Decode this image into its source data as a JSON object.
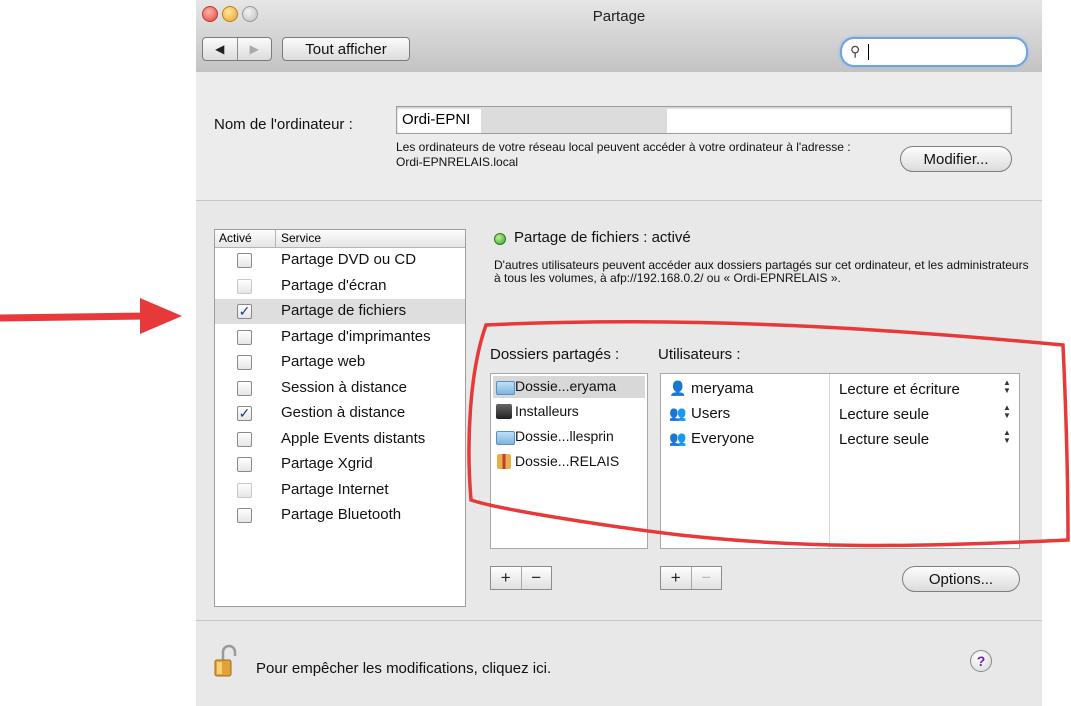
{
  "window": {
    "title": "Partage",
    "show_all": "Tout afficher",
    "nav_back": "◀",
    "nav_forward": "▶"
  },
  "search": {
    "placeholder": ""
  },
  "computer_name": {
    "label": "Nom de l'ordinateur :",
    "value": "Ordi-EPNI",
    "address_text": "Les ordinateurs de votre réseau local peuvent accéder à votre ordinateur à l'adresse : Ordi-EPNRELAIS.local",
    "modify_button": "Modifier..."
  },
  "services": {
    "header_enabled": "Activé",
    "header_service": "Service",
    "items": [
      {
        "label": "Partage DVD ou CD",
        "checked": false,
        "enabled": true
      },
      {
        "label": "Partage d'écran",
        "checked": false,
        "enabled": false
      },
      {
        "label": "Partage de fichiers",
        "checked": true,
        "enabled": true,
        "selected": true
      },
      {
        "label": "Partage d'imprimantes",
        "checked": false,
        "enabled": true
      },
      {
        "label": "Partage web",
        "checked": false,
        "enabled": true
      },
      {
        "label": "Session à distance",
        "checked": false,
        "enabled": true
      },
      {
        "label": "Gestion à distance",
        "checked": true,
        "enabled": true
      },
      {
        "label": "Apple Events distants",
        "checked": false,
        "enabled": true
      },
      {
        "label": "Partage Xgrid",
        "checked": false,
        "enabled": true
      },
      {
        "label": "Partage Internet",
        "checked": false,
        "enabled": false
      },
      {
        "label": "Partage Bluetooth",
        "checked": false,
        "enabled": true
      }
    ]
  },
  "status": {
    "text": "Partage de fichiers : activé",
    "description": "D'autres utilisateurs peuvent accéder aux dossiers partagés sur cet ordinateur, et les administrateurs à tous les volumes, à afp://192.168.0.2/ ou « Ordi-EPNRELAIS ».",
    "color": "#3aa522"
  },
  "shared_folders": {
    "label": "Dossiers partagés :",
    "items": [
      {
        "label": "Dossie...eryama",
        "icon": "folder-icon",
        "selected": true
      },
      {
        "label": "Installeurs",
        "icon": "box-icon"
      },
      {
        "label": "Dossie...llesprin",
        "icon": "folder-icon"
      },
      {
        "label": "Dossie...RELAIS",
        "icon": "gift-icon"
      }
    ]
  },
  "users": {
    "label": "Utilisateurs :",
    "items": [
      {
        "name": "meryama",
        "icon": "user-icon",
        "permission": "Lecture et écriture"
      },
      {
        "name": "Users",
        "icon": "group-icon",
        "permission": "Lecture seule"
      },
      {
        "name": "Everyone",
        "icon": "everyone-icon",
        "permission": "Lecture seule"
      }
    ]
  },
  "buttons": {
    "plus": "+",
    "minus": "−",
    "options": "Options..."
  },
  "lock": {
    "text": "Pour empêcher les modifications, cliquez ici.",
    "help": "?"
  },
  "annotation": {
    "color": "#e8393a"
  }
}
